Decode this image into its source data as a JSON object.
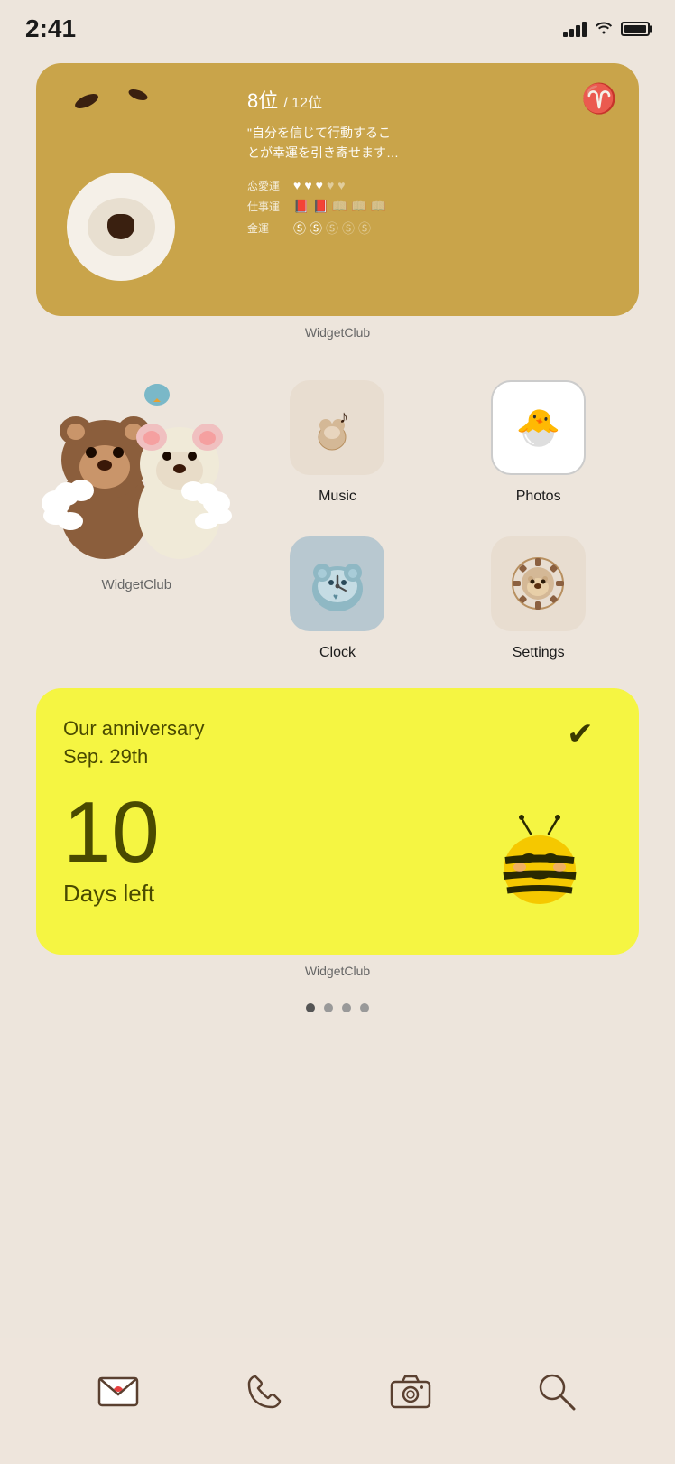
{
  "statusBar": {
    "time": "2:41",
    "battery": "full"
  },
  "widget1": {
    "rank": "8位",
    "total": "/ 12位",
    "quote": "\"自分を信じて行動するこ\nとが幸運を引き寄せます…",
    "love_label": "恋愛運",
    "work_label": "仕事運",
    "money_label": "金運",
    "label": "WidgetClub"
  },
  "apps": {
    "music_label": "Music",
    "photos_label": "Photos",
    "clock_label": "Clock",
    "settings_label": "Settings",
    "widgetclub_label": "WidgetClub"
  },
  "widget2": {
    "title_line1": "Our anniversary",
    "title_line2": "Sep. 29th",
    "number": "10",
    "days_label": "Days left",
    "label": "WidgetClub"
  },
  "dock": {
    "mail_label": "Mail",
    "phone_label": "Phone",
    "camera_label": "Camera",
    "search_label": "Search"
  },
  "pageDots": [
    "active",
    "inactive",
    "inactive",
    "inactive"
  ]
}
